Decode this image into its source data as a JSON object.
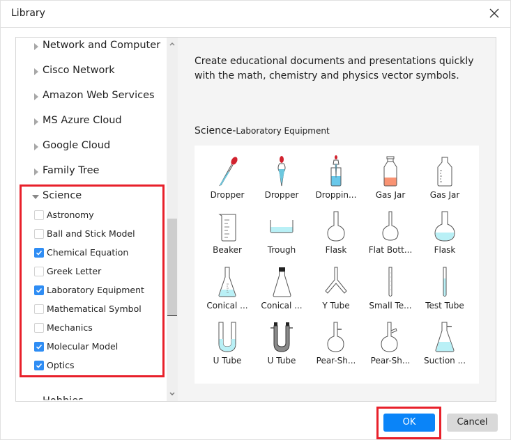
{
  "dialog": {
    "title": "Library",
    "close_icon": "close-icon"
  },
  "tree": {
    "categories": [
      {
        "label": "Network and Computer",
        "expanded": false
      },
      {
        "label": "Cisco Network",
        "expanded": false
      },
      {
        "label": "Amazon Web Services",
        "expanded": false
      },
      {
        "label": "MS Azure Cloud",
        "expanded": false
      },
      {
        "label": "Google Cloud",
        "expanded": false
      },
      {
        "label": "Family Tree",
        "expanded": false
      },
      {
        "label": "Science",
        "expanded": true
      }
    ],
    "science_items": [
      {
        "label": "Astronomy",
        "checked": false
      },
      {
        "label": "Ball and Stick Model",
        "checked": false
      },
      {
        "label": "Chemical Equation",
        "checked": true
      },
      {
        "label": "Greek Letter",
        "checked": false
      },
      {
        "label": "Laboratory Equipment",
        "checked": true
      },
      {
        "label": "Mathematical Symbol",
        "checked": false
      },
      {
        "label": "Mechanics",
        "checked": false
      },
      {
        "label": "Molecular Model",
        "checked": true
      },
      {
        "label": "Optics",
        "checked": true
      }
    ],
    "partial_next_item": "Hobbies"
  },
  "preview": {
    "description": "Create educational documents and presentations quickly with the math, chemistry and physics vector symbols.",
    "section_main": "Science-",
    "section_sub": "Laboratory Equipment",
    "shapes": [
      {
        "label": "Dropper",
        "icon": "dropper-icon"
      },
      {
        "label": "Dropper",
        "icon": "bulb-dropper-icon"
      },
      {
        "label": "Droppin...",
        "icon": "dropping-bottle-icon"
      },
      {
        "label": "Gas Jar",
        "icon": "gas-jar-filled-icon"
      },
      {
        "label": "Gas Jar",
        "icon": "gas-jar-icon"
      },
      {
        "label": "Beaker",
        "icon": "beaker-icon"
      },
      {
        "label": "Trough",
        "icon": "trough-icon"
      },
      {
        "label": "Flask",
        "icon": "flask-icon"
      },
      {
        "label": "Flat Bott...",
        "icon": "flat-bottom-flask-icon"
      },
      {
        "label": "Flask",
        "icon": "flask-filled-icon"
      },
      {
        "label": "Conical ...",
        "icon": "conical-flask-filled-icon"
      },
      {
        "label": "Conical ...",
        "icon": "conical-flask-stopper-icon"
      },
      {
        "label": "Y Tube",
        "icon": "y-tube-icon"
      },
      {
        "label": "Small Te...",
        "icon": "small-test-tube-icon"
      },
      {
        "label": "Test Tube",
        "icon": "test-tube-icon"
      },
      {
        "label": "U Tube",
        "icon": "u-tube-filled-icon"
      },
      {
        "label": "U Tube",
        "icon": "u-tube-packed-icon"
      },
      {
        "label": "Pear-Sh...",
        "icon": "pear-shaped-flask-icon"
      },
      {
        "label": "Pear-Sh...",
        "icon": "pear-shaped-flask-side-icon"
      },
      {
        "label": "Suction ...",
        "icon": "suction-flask-icon"
      }
    ]
  },
  "footer": {
    "ok_label": "OK",
    "cancel_label": "Cancel"
  },
  "colors": {
    "accent": "#0a84f8",
    "checkbox": "#2f8df4",
    "highlight": "#e8202a",
    "liquid_blue": "#b9f0f6",
    "liquid_orange": "#f99373",
    "dropper_red": "#d1222e"
  }
}
